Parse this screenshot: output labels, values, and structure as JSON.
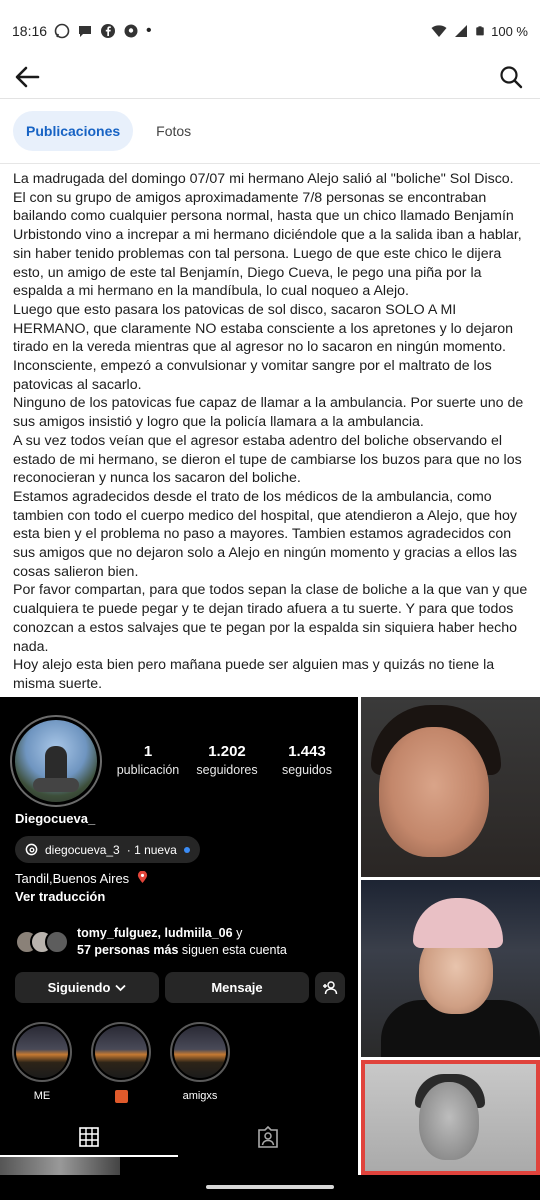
{
  "status_bar": {
    "time": "18:16",
    "battery": "100 %",
    "notification_icons": [
      "whatsapp-icon",
      "chat-icon",
      "facebook-icon",
      "location-icon",
      "dot-icon"
    ],
    "system_icons": [
      "wifi-icon",
      "signal-icon",
      "battery-icon"
    ]
  },
  "app_bar": {
    "back_icon": "arrow-left-icon",
    "search_icon": "search-icon"
  },
  "tabs": [
    {
      "label": "Publicaciones",
      "active": true
    },
    {
      "label": "Fotos",
      "active": false
    }
  ],
  "colors": {
    "accent": "#1763c4",
    "tab_active_bg": "#e8f0fb",
    "dark_bg": "#000000"
  },
  "post": {
    "paragraphs": [
      "La madrugada del domingo 07/07 mi hermano Alejo salió al \"boliche\" Sol Disco. El con su grupo de amigos aproximadamente 7/8 personas se encontraban bailando como cualquier persona normal, hasta que un chico llamado Benjamín Urbistondo vino a increpar a mi hermano diciéndole que a la salida iban a hablar, sin haber tenido problemas con tal persona. Luego de que este chico le dijera esto, un amigo de este tal Benjamín,  Diego Cueva, le pego una piña por la espalda a mi hermano en la mandíbula, lo cual noqueo a Alejo.",
      "Luego que esto pasara los patovicas de sol disco, sacaron SOLO A MI HERMANO, que claramente NO estaba consciente a los apretones y lo dejaron tirado en la vereda mientras que al agresor no lo sacaron en ningún momento. Inconsciente, empezó a convulsionar y vomitar sangre por el maltrato de los patovicas al sacarlo.",
      "Ninguno de los patovicas fue capaz de llamar a la ambulancia. Por suerte uno de sus amigos insistió y logro que la policía llamara a la ambulancia.",
      "A su vez todos veían que el agresor estaba adentro del boliche observando el estado de mi hermano, se dieron el tupe de cambiarse los buzos para que no los reconocieran y nunca los sacaron del boliche.",
      "Estamos agradecidos desde el trato de los médicos de la ambulancia, como tambien con todo el cuerpo medico del hospital, que atendieron a Alejo, que hoy esta bien y el problema no paso a mayores. Tambien estamos agradecidos con sus amigos que no dejaron solo a Alejo en ningún momento y gracias a ellos las cosas salieron bien.",
      "Por favor compartan, para que todos sepan la clase de boliche a la que van y que cualquiera te puede pegar y te dejan tirado afuera a tu suerte. Y para que todos conozcan a estos salvajes que te pegan por la espalda sin siquiera haber hecho nada.",
      "Hoy alejo esta bien pero mañana puede ser alguien mas y quizás no tiene la misma suerte."
    ]
  },
  "ig_profile": {
    "stats": [
      {
        "num": "1",
        "label": "publicación"
      },
      {
        "num": "1.202",
        "label": "seguidores"
      },
      {
        "num": "1.443",
        "label": "seguidos"
      }
    ],
    "username": "Diegocueva_",
    "threads_handle": "diegocueva_3",
    "threads_badge": "· 1 nueva",
    "location": "Tandil,Buenos Aires",
    "translate": "Ver traducción",
    "followed_by_names": "tomy_fulguez, ludmiila_06",
    "followed_by_conj": " y",
    "followed_by_more": "57 personas más",
    "followed_by_tail": " siguen esta cuenta",
    "following_button": "Siguiendo",
    "message_button": "Mensaje",
    "highlights": [
      {
        "label": "ME"
      },
      {
        "label": ""
      },
      {
        "label": "amigxs"
      }
    ]
  }
}
